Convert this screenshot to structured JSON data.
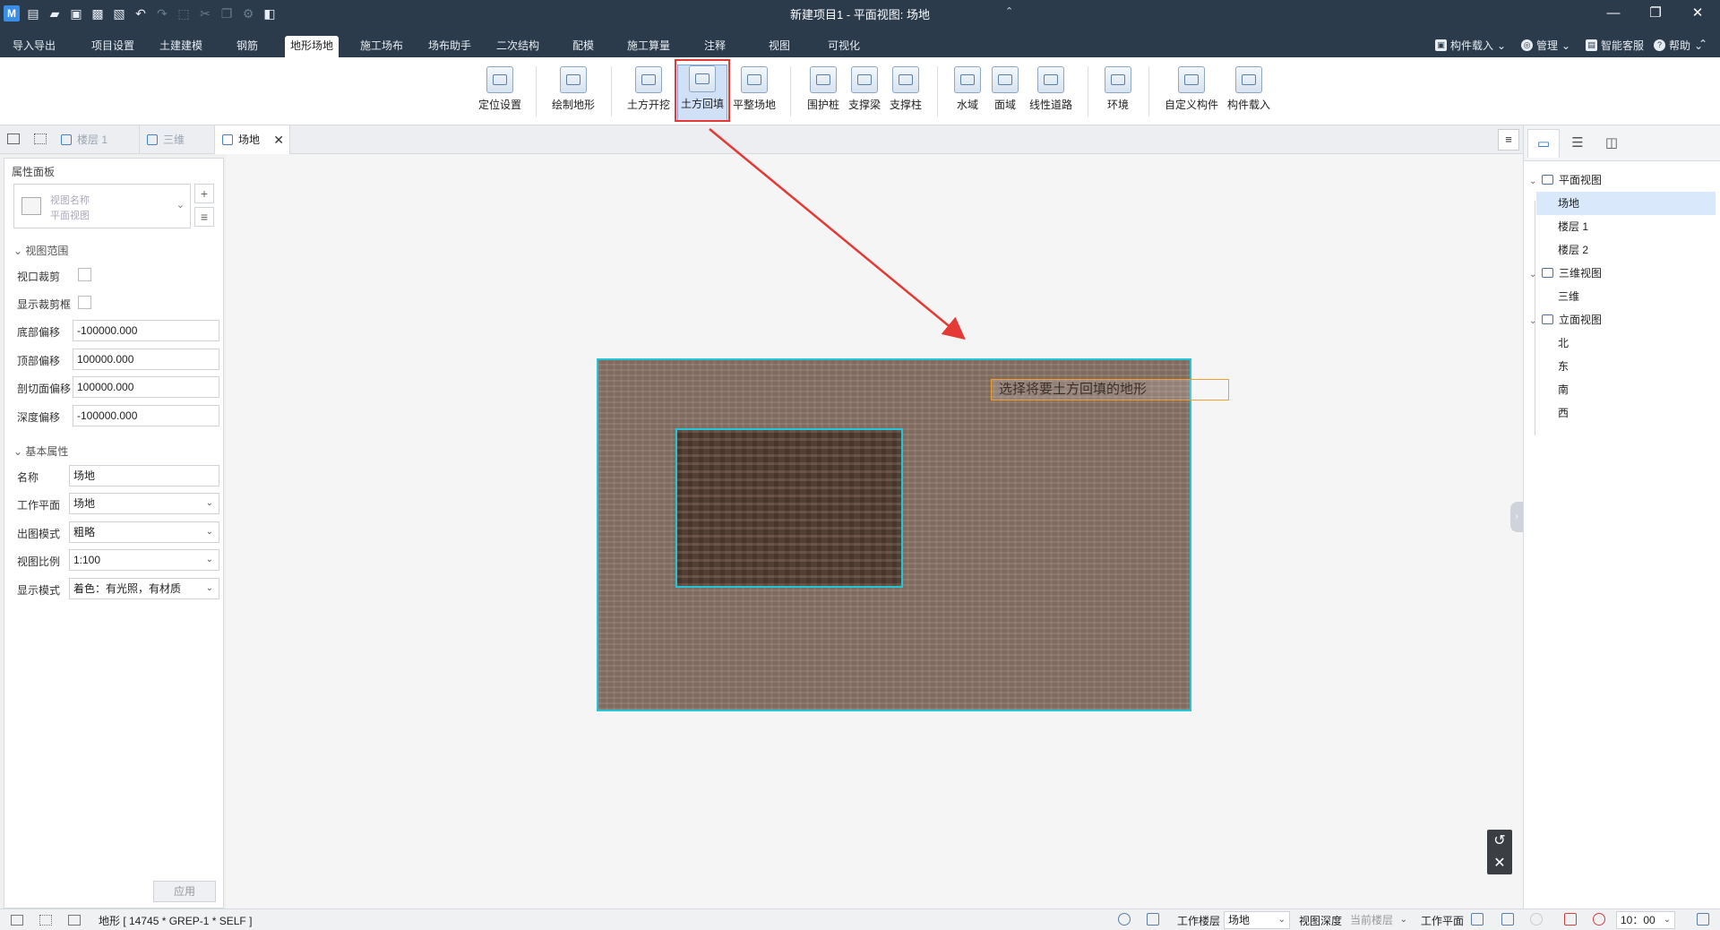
{
  "titlebar": {
    "title": "新建项目1 - 平面视图: 场地",
    "logo": "M",
    "window_controls": [
      "—",
      "❐",
      "✕"
    ]
  },
  "menu": {
    "tabs": [
      "导入导出",
      "项目设置",
      "土建建模",
      "钢筋",
      "地形场地",
      "施工场布",
      "场布助手",
      "二次结构",
      "配模",
      "施工算量",
      "注释",
      "视图",
      "可视化"
    ],
    "active_tab": "地形场地",
    "right": {
      "component_load": "构件载入",
      "manage": "管理",
      "smart_service": "智能客服",
      "help": "帮助"
    }
  },
  "ribbon": {
    "buttons": [
      "定位设置",
      "绘制地形",
      "土方开挖",
      "土方回填",
      "平整场地",
      "围护桩",
      "支撑梁",
      "支撑柱",
      "水域",
      "面域",
      "线性道路",
      "环境",
      "自定义构件",
      "构件载入"
    ],
    "active": "土方回填"
  },
  "doc_tabs": {
    "floor1": "楼层 1",
    "three_d": "三维",
    "site": "场地"
  },
  "properties": {
    "title": "属性面板",
    "view_name_label": "视图名称",
    "view_type": "平面视图",
    "section_view_range": "视图范围",
    "viewport_crop": "视口裁剪",
    "show_crop_frame": "显示裁剪框",
    "bottom_offset": {
      "label": "底部偏移",
      "value": "-100000.000"
    },
    "top_offset": {
      "label": "顶部偏移",
      "value": "100000.000"
    },
    "cut_offset": {
      "label": "剖切面偏移",
      "value": "100000.000"
    },
    "depth_offset": {
      "label": "深度偏移",
      "value": "-100000.000"
    },
    "section_basic": "基本属性",
    "name": {
      "label": "名称",
      "value": "场地"
    },
    "work_plane": {
      "label": "工作平面",
      "value": "场地"
    },
    "output_mode": {
      "label": "出图模式",
      "value": "粗略"
    },
    "view_scale": {
      "label": "视图比例",
      "value": "1:100"
    },
    "display_mode": {
      "label": "显示模式",
      "value": "着色：有光照，有材质"
    },
    "apply": "应用"
  },
  "canvas": {
    "hint": "选择将要土方回填的地形"
  },
  "tree": {
    "plan_views": "平面视图",
    "site": "场地",
    "floor1": "楼层 1",
    "floor2": "楼层 2",
    "views_3d": "三维视图",
    "three_d": "三维",
    "elevations": "立面视图",
    "north": "北",
    "east": "东",
    "south": "南",
    "west": "西"
  },
  "status": {
    "selection": "地形 [ 14745 * GREP-1 * SELF ]",
    "work_floor_label": "工作楼层",
    "work_floor_value": "场地",
    "view_depth_label": "视图深度",
    "view_depth_value": "当前楼层",
    "work_plane_label": "工作平面",
    "time": "10：00"
  },
  "colors": {
    "accent_red": "#e53935",
    "selection_cyan": "#23c6d6",
    "dark_header": "#2b3b4c"
  }
}
